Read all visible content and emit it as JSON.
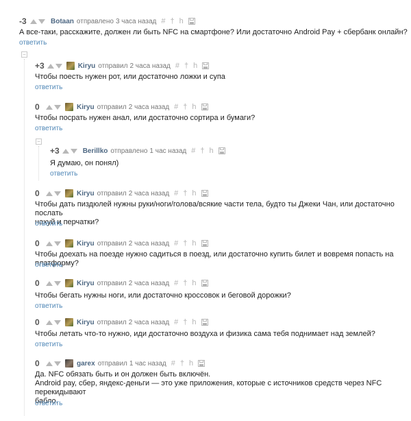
{
  "actions": {
    "reply": "ответить"
  },
  "comments": [
    {
      "score": "-3",
      "author": "Botaan",
      "verb": "отправлено",
      "time": "3 часа назад",
      "lines": [
        "А все-таки, расскажите, должен ли быть NFC на смартфоне? Или достаточно Android Pay + сбербанк онлайн?"
      ]
    },
    {
      "score": "+3",
      "author": "Kiryu",
      "verb": "отправил",
      "time": "2 часа назад",
      "lines": [
        "Чтобы поесть нужен рот, или достаточно ложки и супа"
      ]
    },
    {
      "score": "0",
      "author": "Kiryu",
      "verb": "отправил",
      "time": "2 часа назад",
      "lines": [
        "Чтобы посрать нужен анал, или достаточно сортира и бумаги?"
      ]
    },
    {
      "score": "+3",
      "author": "Berillko",
      "verb": "отправлено",
      "time": "1 час назад",
      "lines": [
        "Я думаю, он понял)"
      ]
    },
    {
      "score": "0",
      "author": "Kiryu",
      "verb": "отправил",
      "time": "2 часа назад",
      "lines": [
        "Чтобы дать пиздюлей нужны руки/ноги/голова/всякие части тела, будто ты Джеки Чан, или достаточно послать",
        "нахуй и перчатки?"
      ]
    },
    {
      "score": "0",
      "author": "Kiryu",
      "verb": "отправил",
      "time": "2 часа назад",
      "lines": [
        "Чтобы доехать на поезде нужно садиться в поезд, или достаточно купить билет и вовремя попасть на платформу?"
      ]
    },
    {
      "score": "0",
      "author": "Kiryu",
      "verb": "отправил",
      "time": "2 часа назад",
      "lines": [
        "Чтобы бегать нужны ноги, или достаточно кроссовок и беговой дорожки?"
      ]
    },
    {
      "score": "0",
      "author": "Kiryu",
      "verb": "отправил",
      "time": "2 часа назад",
      "lines": [
        "Чтобы летать что-то нужно, иди достаточно воздуха и физика сама тебя поднимает над землей?"
      ]
    },
    {
      "score": "0",
      "author": "garex",
      "verb": "отправил",
      "time": "1 час назад",
      "lines": [
        "Да. NFC обязать быть и он должен быть включён.",
        "Android pay, сбер, яндекс-деньги — это уже приложения, которые с источников средств через NFC перекидывают",
        "бабло."
      ]
    }
  ]
}
